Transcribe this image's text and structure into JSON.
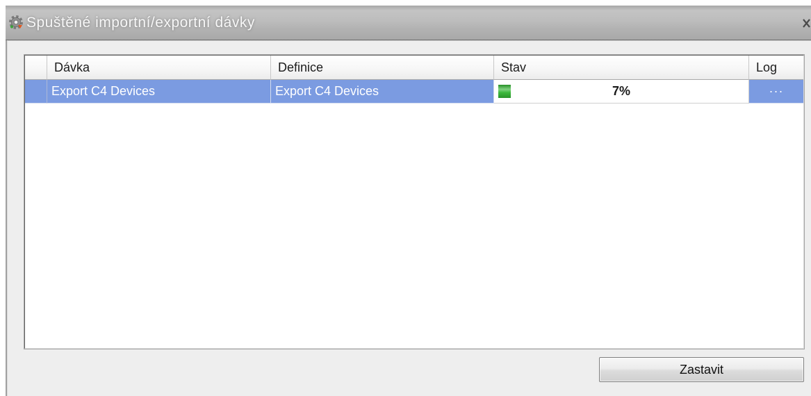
{
  "window": {
    "title": "Spuštěné importní/exportní dávky",
    "icon": "gear-icon",
    "close_icon": "close-icon"
  },
  "grid": {
    "columns": [
      "Dávka",
      "Definice",
      "Stav",
      "Log"
    ],
    "rows": [
      {
        "selected": true,
        "davka": "Export C4 Devices",
        "definice": "Export C4 Devices",
        "stav": {
          "progress": 7,
          "label": "7%"
        },
        "log": "···"
      }
    ]
  },
  "footer": {
    "stop_button": "Zastavit"
  },
  "colors": {
    "selection": "#7b9be1",
    "selection_text": "#ffffff",
    "progress": "#3cb83c",
    "title_bar": "#b5b5b5"
  }
}
